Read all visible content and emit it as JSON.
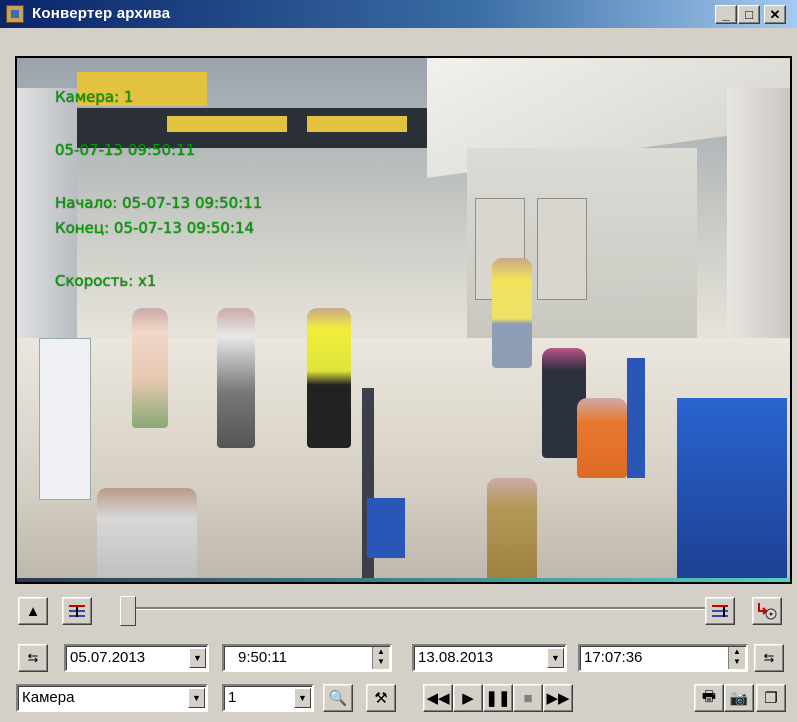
{
  "window": {
    "title": "Конвертер архива",
    "controls": {
      "minimize": "_",
      "maximize": "□",
      "close": "✕"
    }
  },
  "video": {
    "overlay": {
      "camera": "Камера: 1",
      "timestamp": "05-07-13 09:50:11",
      "start": "Начало: 05-07-13 09:50:11",
      "end": "Конец: 05-07-13 09:50:14",
      "speed": "Скорость: x1"
    }
  },
  "timeline": {
    "position": 0.0
  },
  "range": {
    "start_date": "05.07.2013",
    "start_time": "9:50:11",
    "end_date": "13.08.2013",
    "end_time": "17:07:36"
  },
  "bottom": {
    "source_select": "Камера",
    "camera_number": "1"
  },
  "icons": {
    "collapse": "up-arrow-icon",
    "mark_start": "mark-start-icon",
    "mark_end": "mark-end-icon",
    "export": "export-icon",
    "search": "search-icon",
    "settings": "tools-icon",
    "rewind": "rewind-icon",
    "play": "play-icon",
    "pause": "pause-icon",
    "stop": "stop-icon",
    "fast_forward": "fast-forward-icon",
    "print": "printer-icon",
    "snapshot": "camera-icon",
    "copy": "copy-icon"
  }
}
